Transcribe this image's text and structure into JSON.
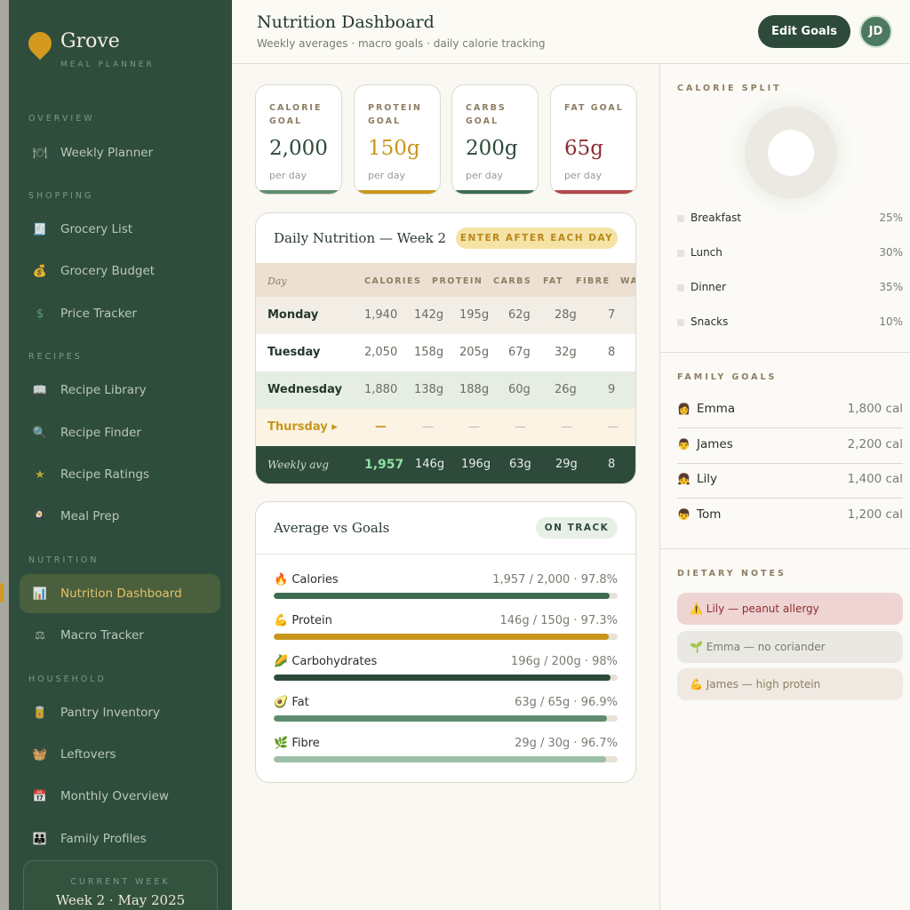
{
  "sidebar": {
    "brand": "Grove",
    "brand_sub": "MEAL PLANNER",
    "sections": [
      "OVERVIEW",
      "SHOPPING",
      "RECIPES",
      "NUTRITION",
      "HOUSEHOLD"
    ],
    "items": [
      {
        "label": "Weekly Planner",
        "icon": "plate-icon"
      },
      {
        "label": "Grocery List",
        "icon": "receipt-icon"
      },
      {
        "label": "Grocery Budget",
        "icon": "money-bag-icon"
      },
      {
        "label": "Price Tracker",
        "icon": "dollar-icon"
      },
      {
        "label": "Recipe Library",
        "icon": "book-icon"
      },
      {
        "label": "Recipe Finder",
        "icon": "magnifier-icon"
      },
      {
        "label": "Recipe Ratings",
        "icon": "star-icon"
      },
      {
        "label": "Meal Prep",
        "icon": "pan-icon"
      },
      {
        "label": "Nutrition Dashboard",
        "icon": "chart-icon"
      },
      {
        "label": "Macro Tracker",
        "icon": "scale-icon"
      },
      {
        "label": "Pantry Inventory",
        "icon": "jar-icon"
      },
      {
        "label": "Leftovers",
        "icon": "basket-icon"
      },
      {
        "label": "Monthly Overview",
        "icon": "calendar-icon"
      },
      {
        "label": "Family Profiles",
        "icon": "family-icon"
      }
    ],
    "current_week_label": "CURRENT WEEK",
    "current_week_value": "Week 2 · May 2025"
  },
  "header": {
    "title": "Nutrition Dashboard",
    "subtitle": "Weekly averages · macro goals · daily calorie tracking",
    "edit_button": "Edit Goals",
    "avatar": "JD"
  },
  "goals": [
    {
      "label": "CALORIE GOAL",
      "value": "2,000",
      "sub": "per day",
      "color": "#2d4a3a",
      "bar": "#5f8c6f"
    },
    {
      "label": "PROTEIN GOAL",
      "value": "150g",
      "sub": "per day",
      "color": "#c8961c",
      "bar": "#c8961c"
    },
    {
      "label": "CARBS GOAL",
      "value": "200g",
      "sub": "per day",
      "color": "#2d4a3a",
      "bar": "#3e6b52"
    },
    {
      "label": "FAT GOAL",
      "value": "65g",
      "sub": "per day",
      "color": "#8e2e34",
      "bar": "#b4454b"
    }
  ],
  "daily": {
    "title": "Daily Nutrition — Week 2",
    "badge": "ENTER AFTER EACH DAY",
    "columns": [
      "Day",
      "CALORIES",
      "PROTEIN",
      "CARBS",
      "FAT",
      "FIBRE",
      "WA"
    ],
    "rows": [
      {
        "day": "Monday",
        "cells": [
          "1,940",
          "142g",
          "195g",
          "62g",
          "28g",
          "7"
        ]
      },
      {
        "day": "Tuesday",
        "cells": [
          "2,050",
          "158g",
          "205g",
          "67g",
          "32g",
          "8"
        ]
      },
      {
        "day": "Wednesday",
        "cells": [
          "1,880",
          "138g",
          "188g",
          "60g",
          "26g",
          "9"
        ]
      },
      {
        "day": "Thursday ▸",
        "cells": [
          "—",
          "—",
          "—",
          "—",
          "—",
          "—"
        ]
      }
    ],
    "avg": {
      "day": "Weekly avg",
      "cells": [
        "1,957",
        "146g",
        "196g",
        "63g",
        "29g",
        "8"
      ]
    }
  },
  "avg_goals": {
    "title": "Average vs Goals",
    "badge": "ON TRACK",
    "metrics": [
      {
        "label": "Calories",
        "value": "1,957 / 2,000 · 97.8%",
        "pct": 97.8,
        "icon": "🔥",
        "color": "#3e6b52"
      },
      {
        "label": "Protein",
        "value": "146g / 150g · 97.3%",
        "pct": 97.3,
        "icon": "💪",
        "color": "#c8961c"
      },
      {
        "label": "Carbohydrates",
        "value": "196g / 200g · 98%",
        "pct": 98,
        "icon": "🌽",
        "color": "#2d4a3a"
      },
      {
        "label": "Fat",
        "value": "63g / 65g · 96.9%",
        "pct": 96.9,
        "icon": "🥑",
        "color": "#5f8c6f"
      },
      {
        "label": "Fibre",
        "value": "29g / 30g · 96.7%",
        "pct": 96.7,
        "icon": "🌿",
        "color": "#9cbfa6"
      }
    ]
  },
  "calorie_split": {
    "title": "CALORIE SPLIT",
    "items": [
      {
        "name": "Breakfast",
        "pct": "25%"
      },
      {
        "name": "Lunch",
        "pct": "30%"
      },
      {
        "name": "Dinner",
        "pct": "35%"
      },
      {
        "name": "Snacks",
        "pct": "10%"
      }
    ]
  },
  "family": {
    "title": "FAMILY GOALS",
    "members": [
      {
        "name": "Emma",
        "cal": "1,800 cal",
        "icon": "👩"
      },
      {
        "name": "James",
        "cal": "2,200 cal",
        "icon": "👨"
      },
      {
        "name": "Lily",
        "cal": "1,400 cal",
        "icon": "👧"
      },
      {
        "name": "Tom",
        "cal": "1,200 cal",
        "icon": "👦"
      }
    ]
  },
  "dietary": {
    "title": "DIETARY NOTES",
    "notes": [
      {
        "text": "⚠️ Lily — peanut allergy",
        "bg": "#eed4d2",
        "fg": "#8e2e34"
      },
      {
        "text": "🌱 Emma — no coriander",
        "bg": "#e9e8e3",
        "fg": "#7b7b72"
      },
      {
        "text": "💪 James — high protein",
        "bg": "#efe9e1",
        "fg": "#8d7e62"
      }
    ]
  }
}
